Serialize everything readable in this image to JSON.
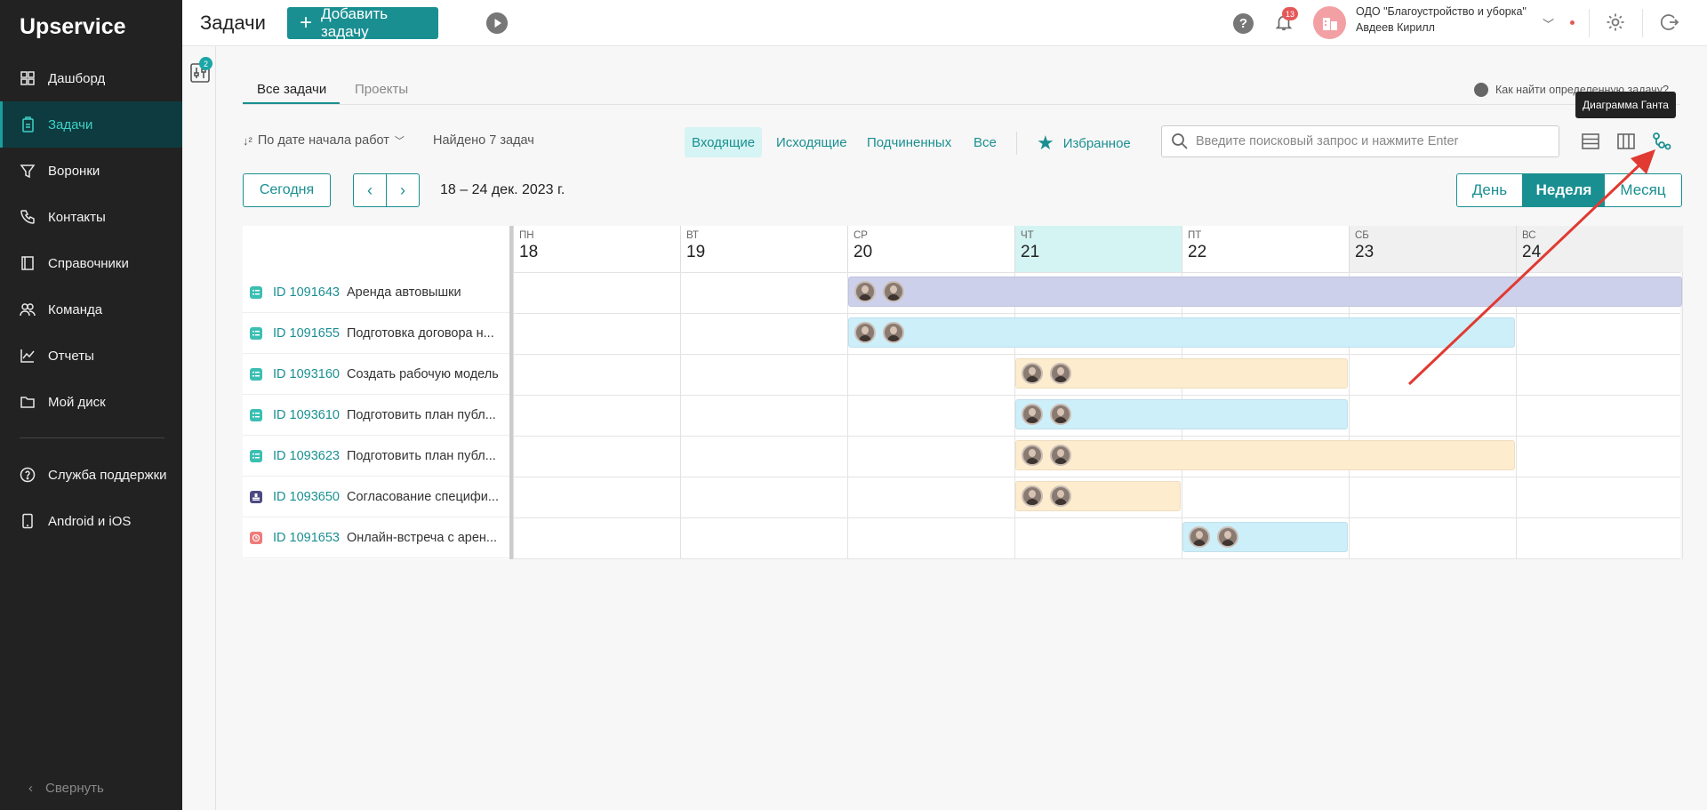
{
  "brand": "Upservice",
  "sidebar": {
    "items": [
      {
        "label": "Дашборд",
        "icon": "dashboard-icon"
      },
      {
        "label": "Задачи",
        "icon": "tasks-icon",
        "active": true
      },
      {
        "label": "Воронки",
        "icon": "funnel-icon"
      },
      {
        "label": "Контакты",
        "icon": "phone-icon"
      },
      {
        "label": "Справочники",
        "icon": "book-icon"
      },
      {
        "label": "Команда",
        "icon": "team-icon"
      },
      {
        "label": "Отчеты",
        "icon": "chart-icon"
      },
      {
        "label": "Мой диск",
        "icon": "folder-icon"
      },
      {
        "label": "Служба поддержки",
        "icon": "help-circle-icon"
      },
      {
        "label": "Android и iOS",
        "icon": "mobile-icon"
      }
    ],
    "collapse_label": "Свернуть"
  },
  "filter_badge": "2",
  "header": {
    "title": "Задачи",
    "add_task_label": "Добавить задачу",
    "help": "?",
    "notifications_count": "13",
    "org_name": "ОДО \"Благоустройство и уборка\"",
    "user_name": "Авдеев Кирилл"
  },
  "tabs": {
    "all": "Все задачи",
    "projects": "Проекты"
  },
  "help_link": "Как найти определенную задачу?",
  "toolbar": {
    "sort_label": "По дате начала работ",
    "found": "Найдено 7 задач",
    "filters": [
      "Входящие",
      "Исходящие",
      "Подчиненных",
      "Все"
    ],
    "favorites": "Избранное",
    "search_placeholder": "Введите поисковый запрос и нажмите Enter",
    "tooltip": "Диаграмма Ганта"
  },
  "calendar": {
    "today": "Сегодня",
    "range": "18 – 24 дек. 2023 г.",
    "scales": [
      "День",
      "Неделя",
      "Месяц"
    ],
    "days": [
      {
        "name": "ПН",
        "date": "18"
      },
      {
        "name": "ВТ",
        "date": "19"
      },
      {
        "name": "СР",
        "date": "20"
      },
      {
        "name": "ЧТ",
        "date": "21",
        "today": true
      },
      {
        "name": "ПТ",
        "date": "22"
      },
      {
        "name": "СБ",
        "date": "23",
        "weekend": true
      },
      {
        "name": "ВС",
        "date": "24",
        "weekend": true
      }
    ]
  },
  "tasks": [
    {
      "id": "ID 1091643",
      "name": "Аренда автовышки",
      "type": "list",
      "start": 2,
      "end": 7,
      "color": "#cdd0ea"
    },
    {
      "id": "ID 1091655",
      "name": "Подготовка договора н...",
      "type": "list",
      "start": 2,
      "end": 6,
      "color": "#cdeffa"
    },
    {
      "id": "ID 1093160",
      "name": "Создать рабочую модель",
      "type": "list",
      "start": 3,
      "end": 5,
      "color": "#fdeccd"
    },
    {
      "id": "ID 1093610",
      "name": "Подготовить план публ...",
      "type": "list",
      "start": 3,
      "end": 5,
      "color": "#cdeffa"
    },
    {
      "id": "ID 1093623",
      "name": "Подготовить план публ...",
      "type": "list",
      "start": 3,
      "end": 6,
      "color": "#fdeccd"
    },
    {
      "id": "ID 1093650",
      "name": "Согласование специфи...",
      "type": "approval",
      "start": 3,
      "end": 4,
      "color": "#fdeccd"
    },
    {
      "id": "ID 1091653",
      "name": "Онлайн-встреча с арен...",
      "type": "meeting",
      "start": 4,
      "end": 5,
      "color": "#cdeffa"
    }
  ],
  "colors": {
    "accent": "#1a8f91",
    "annotation_arrow": "#e03a32"
  }
}
